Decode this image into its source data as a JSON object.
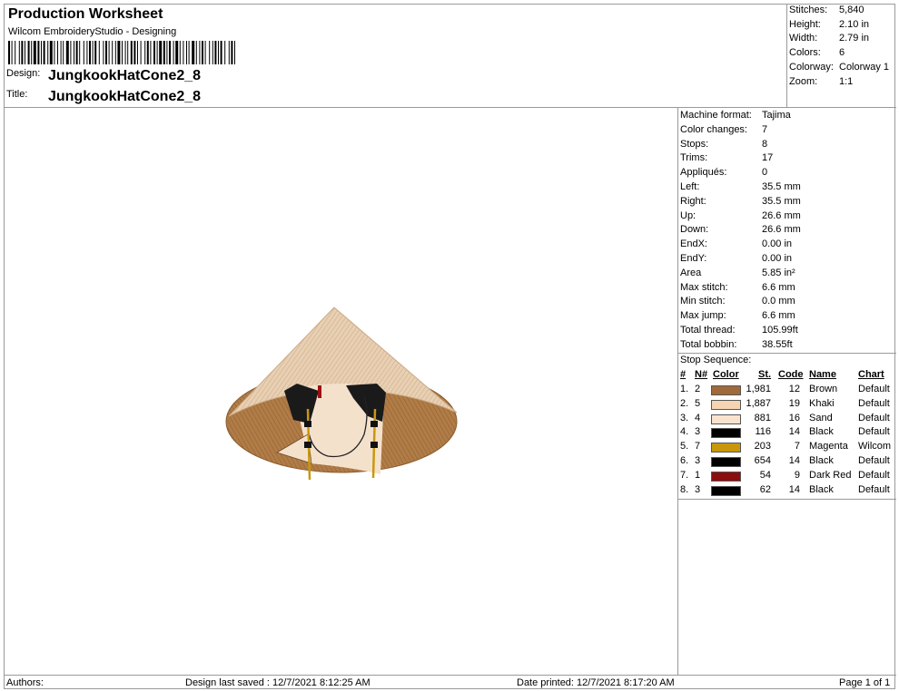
{
  "header": {
    "title": "Production Worksheet",
    "subtitle": "Wilcom EmbroideryStudio - Designing",
    "design_label": "Design:",
    "design_value": "JungkookHatCone2_8",
    "title_label": "Title:",
    "title_value": "JungkookHatCone2_8"
  },
  "stats": [
    {
      "k": "Stitches:",
      "v": "5,840"
    },
    {
      "k": "Height:",
      "v": "2.10 in"
    },
    {
      "k": "Width:",
      "v": "2.79 in"
    },
    {
      "k": "Colors:",
      "v": "6"
    },
    {
      "k": "Colorway:",
      "v": "Colorway 1"
    },
    {
      "k": "Zoom:",
      "v": "1:1"
    }
  ],
  "info": [
    {
      "k": "Machine format:",
      "v": "Tajima"
    },
    {
      "k": "Color changes:",
      "v": "7"
    },
    {
      "k": "Stops:",
      "v": "8"
    },
    {
      "k": "Trims:",
      "v": "17"
    },
    {
      "k": "Appliqués:",
      "v": "0"
    },
    {
      "k": "Left:",
      "v": "35.5 mm"
    },
    {
      "k": "Right:",
      "v": "35.5 mm"
    },
    {
      "k": "Up:",
      "v": "26.6 mm"
    },
    {
      "k": "Down:",
      "v": "26.6 mm"
    },
    {
      "k": "EndX:",
      "v": "0.00 in"
    },
    {
      "k": "EndY:",
      "v": "0.00 in"
    },
    {
      "k": "Area",
      "v": "  5.85 in²"
    },
    {
      "k": "Max stitch:",
      "v": "6.6 mm"
    },
    {
      "k": "Min stitch:",
      "v": "0.0 mm"
    },
    {
      "k": "Max jump:",
      "v": "6.6 mm"
    },
    {
      "k": "Total thread:",
      "v": "105.99ft"
    },
    {
      "k": "Total bobbin:",
      "v": "38.55ft"
    }
  ],
  "stop_sequence": {
    "title": "Stop Sequence:",
    "headers": {
      "num": "#",
      "n": "N#",
      "color": "Color",
      "st": "St.",
      "code": "Code",
      "name": "Name",
      "chart": "Chart"
    },
    "rows": [
      {
        "num": "1.",
        "n": "2",
        "color": "#a0693a",
        "st": "1,981",
        "code": "12",
        "name": "Brown",
        "chart": "Default"
      },
      {
        "num": "2.",
        "n": "5",
        "color": "#f6d3b2",
        "st": "1,887",
        "code": "19",
        "name": "Khaki",
        "chart": "Default"
      },
      {
        "num": "3.",
        "n": "4",
        "color": "#f9e3ce",
        "st": "881",
        "code": "16",
        "name": "Sand",
        "chart": "Default"
      },
      {
        "num": "4.",
        "n": "3",
        "color": "#000000",
        "st": "116",
        "code": "14",
        "name": "Black",
        "chart": "Default"
      },
      {
        "num": "5.",
        "n": "7",
        "color": "#c9970e",
        "st": "203",
        "code": "7",
        "name": "Magenta",
        "chart": "Wilcom"
      },
      {
        "num": "6.",
        "n": "3",
        "color": "#000000",
        "st": "654",
        "code": "14",
        "name": "Black",
        "chart": "Default"
      },
      {
        "num": "7.",
        "n": "1",
        "color": "#8b0d0d",
        "st": "54",
        "code": "9",
        "name": "Dark Red",
        "chart": "Default"
      },
      {
        "num": "8.",
        "n": "3",
        "color": "#000000",
        "st": "62",
        "code": "14",
        "name": "Black",
        "chart": "Default"
      }
    ]
  },
  "footer": {
    "authors": "Authors:",
    "saved": "Design last saved : 12/7/2021 8:12:25 AM",
    "printed": "Date printed: 12/7/2021 8:17:20 AM",
    "page": "Page 1 of 1"
  }
}
